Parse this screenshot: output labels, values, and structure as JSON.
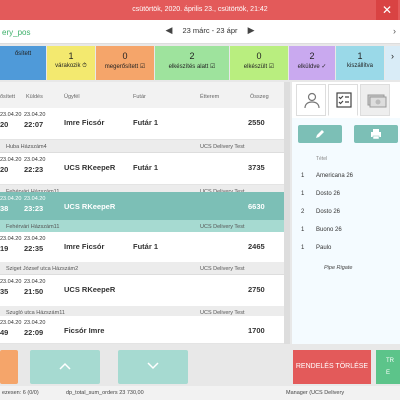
{
  "topbar": {
    "datetime": "csütörtök, 2020. április 23., csütörtök, 21:42",
    "close": "✕"
  },
  "subbar": {
    "app_name": "ery_pos",
    "date_range": "23 márc - 23 ápr",
    "prev": "◀",
    "next": "▶",
    "caret": "›"
  },
  "status_tiles": [
    {
      "count": "",
      "label": "ősített",
      "color": "#4f9ad9"
    },
    {
      "count": "1",
      "label": "várakozik ⏱",
      "color": "#f3e96f"
    },
    {
      "count": "0",
      "label": "megerősített ☑",
      "color": "#f5a56a"
    },
    {
      "count": "2",
      "label": "elkészítés alatt ☑",
      "color": "#9ee39d"
    },
    {
      "count": "0",
      "label": "elkészült ☑",
      "color": "#b9ee7f"
    },
    {
      "count": "2",
      "label": "elküldve ✓",
      "color": "#c9a9ef"
    },
    {
      "count": "1",
      "label": "kiszállítva",
      "color": "#9ad9e8"
    },
    {
      "count": "",
      "label": "›",
      "color": "#d9ecf7"
    }
  ],
  "grid": {
    "headers": [
      "ősített",
      "Küldés",
      "Ügyfél",
      "Futár",
      "Étterem",
      "Összeg"
    ],
    "rows": [
      {
        "t1": "23.04.20",
        "t2": "20",
        "k1": "23.04.20",
        "k2": "22:07",
        "customer": "Imre Ficsór",
        "courier": "Futár 1",
        "amount": "2550",
        "address": "Huba Házszám4",
        "restaurant": "UCS Delivery Test"
      },
      {
        "t1": "23.04.20",
        "t2": "20",
        "k1": "23.04.20",
        "k2": "22:23",
        "customer": "UCS RKeepeR",
        "courier": "Futár 1",
        "amount": "3735",
        "address": "Fehérvári Házszám11",
        "restaurant": "UCS Delivery Test"
      },
      {
        "t1": "23.04.20",
        "t2": "38",
        "k1": "23.04.20",
        "k2": "23:23",
        "customer": "UCS RKeepeR",
        "courier": "",
        "amount": "6630",
        "address": "Fehérvári Házszám11",
        "restaurant": "UCS Delivery Test"
      },
      {
        "t1": "23.04.20",
        "t2": "19",
        "k1": "23.04.20",
        "k2": "22:35",
        "customer": "Imre Ficsór",
        "courier": "Futár 1",
        "amount": "2465",
        "address": "Sziget József utca Házszám2",
        "restaurant": "UCS Delivery Test"
      },
      {
        "t1": "23.04.20",
        "t2": "35",
        "k1": "23.04.20",
        "k2": "21:50",
        "customer": "UCS RKeepeR",
        "courier": "",
        "amount": "2750",
        "address": "Szugló utca Házszám11",
        "restaurant": "UCS Delivery Test"
      },
      {
        "t1": "23.04.20",
        "t2": "49",
        "k1": "23.04.20",
        "k2": "22:09",
        "customer": "Ficsór Imre",
        "courier": "",
        "amount": "1700",
        "address": "",
        "restaurant": ""
      }
    ]
  },
  "detail": {
    "items_header": "Tétel",
    "items": [
      {
        "qty": "1",
        "name": "Americana 26"
      },
      {
        "qty": "1",
        "name": "Dosto 26"
      },
      {
        "qty": "2",
        "name": "Dosto 26"
      },
      {
        "qty": "1",
        "name": "Buono 26"
      },
      {
        "qty": "1",
        "name": "Paulo"
      }
    ],
    "sub_item": "Pipe Rigate"
  },
  "bottom": {
    "delete_label": "RENDELÉS TÖRLÉSE",
    "green_label_1": "TR",
    "green_label_2": "E"
  },
  "footer": {
    "left": "ezesen: 6 (0/0)",
    "center": "dp_total_sum_orders 23 730,00",
    "right": "Manager (UCS Delivery"
  },
  "colors": {
    "accent": "#e35a5a",
    "teal": "#7cbfb6",
    "green": "#3db06a"
  }
}
